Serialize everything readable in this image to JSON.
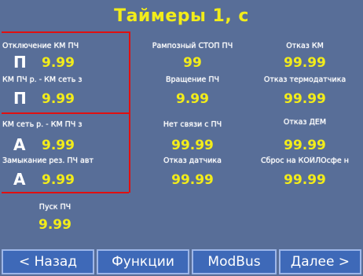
{
  "title": "Таймеры 1, с",
  "left": [
    {
      "label": "Отключение КМ ПЧ",
      "mode": "П",
      "value": "9.99"
    },
    {
      "label": "КМ ПЧ р. - КМ сеть з",
      "mode": "П",
      "value": "9.99"
    },
    {
      "label": "КМ сеть р. - КМ ПЧ з",
      "mode": "А",
      "value": "9.99"
    },
    {
      "label": "Замыкание рез. ПЧ авт",
      "mode": "А",
      "value": "9.99"
    }
  ],
  "middle": [
    {
      "label": "Рампозный СТОП ПЧ",
      "value": "99"
    },
    {
      "label": "Вращение ПЧ",
      "value": "9.99"
    },
    {
      "label": "Нет связи с ПЧ",
      "value": "99.99"
    },
    {
      "label": "Отказ датчика",
      "value": "99.99"
    }
  ],
  "right": [
    {
      "label": "Отказ КМ",
      "value": "99.99"
    },
    {
      "label": "Отказ термодатчика",
      "value": "99.99"
    },
    {
      "label": "Отказ ДЕМ",
      "value": "99.99"
    },
    {
      "label": "Сброс на КОЙЛОсфе н",
      "value": "99.99"
    }
  ],
  "bottom": {
    "label": "Пуск ПЧ",
    "value": "9.99"
  },
  "buttons": {
    "back": "< Назад",
    "functions": "Функции",
    "modbus": "ModBus",
    "next": "Далее >"
  }
}
